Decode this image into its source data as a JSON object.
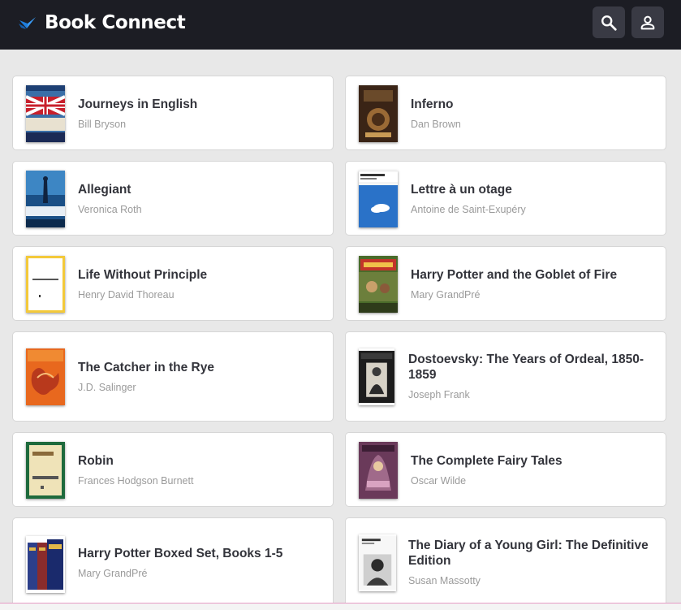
{
  "app": {
    "title": "Book Connect",
    "logo_icon": "book-connect-logo-icon",
    "accent_color": "#1e7fe0",
    "header_background": "#1c1d24"
  },
  "header": {
    "search_icon": "search-icon",
    "profile_icon": "person-icon"
  },
  "books": [
    {
      "title": "Journeys in English",
      "author": "Bill Bryson"
    },
    {
      "title": "Inferno",
      "author": "Dan Brown"
    },
    {
      "title": "Allegiant",
      "author": "Veronica Roth"
    },
    {
      "title": "Lettre à un otage",
      "author": "Antoine de Saint-Exupéry"
    },
    {
      "title": "Life Without Principle",
      "author": "Henry David Thoreau"
    },
    {
      "title": "Harry Potter and the Goblet of Fire",
      "author": "Mary GrandPré"
    },
    {
      "title": "The Catcher in the Rye",
      "author": "J.D. Salinger"
    },
    {
      "title": "Dostoevsky: The Years of Ordeal, 1850-1859",
      "author": "Joseph Frank"
    },
    {
      "title": "Robin",
      "author": "Frances Hodgson Burnett"
    },
    {
      "title": "The Complete Fairy Tales",
      "author": "Oscar Wilde"
    },
    {
      "title": "Harry Potter Boxed Set, Books 1-5",
      "author": "Mary GrandPré"
    },
    {
      "title": "The Diary of a Young Girl: The Definitive Edition",
      "author": "Susan Massotty"
    }
  ]
}
